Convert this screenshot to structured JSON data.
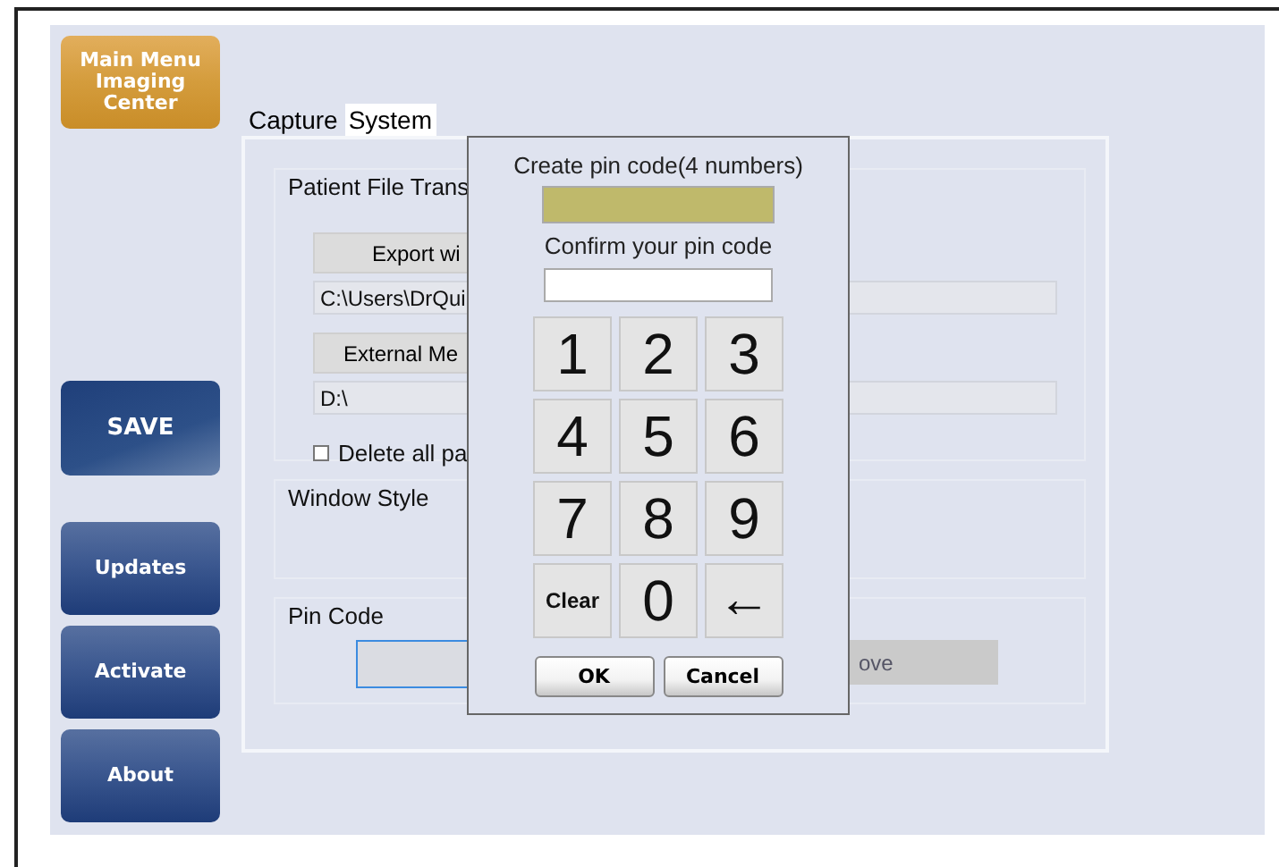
{
  "sidebar": {
    "items": [
      {
        "label": "Main Menu\nImaging\nCenter",
        "kind": "home"
      },
      {
        "label": "SAVE",
        "kind": "save"
      },
      {
        "label": "Updates",
        "kind": "nav"
      },
      {
        "label": "Activate",
        "kind": "nav"
      },
      {
        "label": "About",
        "kind": "nav"
      }
    ]
  },
  "tabs": [
    {
      "label": "Capture",
      "selected": false
    },
    {
      "label": "System",
      "selected": true
    }
  ],
  "patient_file_transfer": {
    "title": "Patient File Trans",
    "export_button": "Export wi",
    "export_path": "C:\\Users\\DrQui",
    "external_button": "External Me",
    "external_path": "D:\\",
    "delete_option": {
      "label": "Delete all pa",
      "checked": false
    }
  },
  "window_style": {
    "title": "Window Style"
  },
  "pin_code": {
    "title": "Pin Code",
    "remove_button": "ove"
  },
  "pin_dialog": {
    "create_label": "Create pin code(4 numbers)",
    "confirm_label": "Confirm your pin code",
    "keys": [
      {
        "label": "1",
        "kind": "digit"
      },
      {
        "label": "2",
        "kind": "digit"
      },
      {
        "label": "3",
        "kind": "digit"
      },
      {
        "label": "4",
        "kind": "digit"
      },
      {
        "label": "5",
        "kind": "digit"
      },
      {
        "label": "6",
        "kind": "digit"
      },
      {
        "label": "7",
        "kind": "digit"
      },
      {
        "label": "8",
        "kind": "digit"
      },
      {
        "label": "9",
        "kind": "digit"
      },
      {
        "label": "Clear",
        "kind": "clear"
      },
      {
        "label": "0",
        "kind": "digit"
      },
      {
        "label": "←",
        "kind": "backspace"
      }
    ],
    "buttons": [
      "OK",
      "Cancel"
    ]
  }
}
